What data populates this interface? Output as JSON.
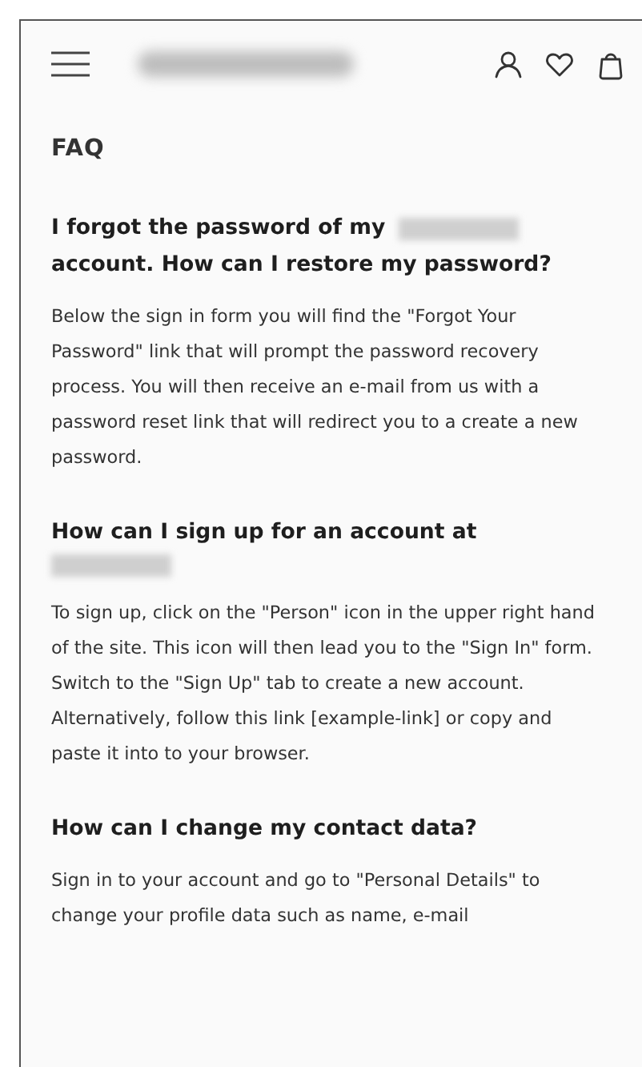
{
  "header": {
    "logo": {
      "kind": "redacted"
    },
    "actions": [
      {
        "kind": "person"
      },
      {
        "kind": "heart"
      },
      {
        "kind": "bag"
      }
    ]
  },
  "title": "FAQ",
  "faqs": [
    {
      "question": [
        {
          "kind": "text",
          "text": "I forgot the password of my"
        },
        {
          "kind": "redacted"
        },
        {
          "kind": "text",
          "text": "account. How can I restore my password?"
        }
      ],
      "answer": "Below the sign in form you will find the \"Forgot Your Password\" link that will prompt the password recovery process. You will then receive an e-mail from us with a password reset link that will redirect you to a create a new password."
    },
    {
      "question": [
        {
          "kind": "text",
          "text": "How can I sign up for an account at"
        },
        {
          "kind": "redacted"
        }
      ],
      "answer": "To sign up, click on the \"Person\" icon in the upper right hand of the site. This icon will then lead you to the \"Sign In\" form. Switch to the \"Sign Up\" tab to create a new account. Alternatively, follow this link [example-link] or copy and paste it into to your browser."
    },
    {
      "question": [
        {
          "kind": "text",
          "text": "How can I change my contact data?"
        }
      ],
      "answer": "Sign in to your account and go to \"Personal Details\" to change your profile data such as name, e-mail"
    }
  ]
}
